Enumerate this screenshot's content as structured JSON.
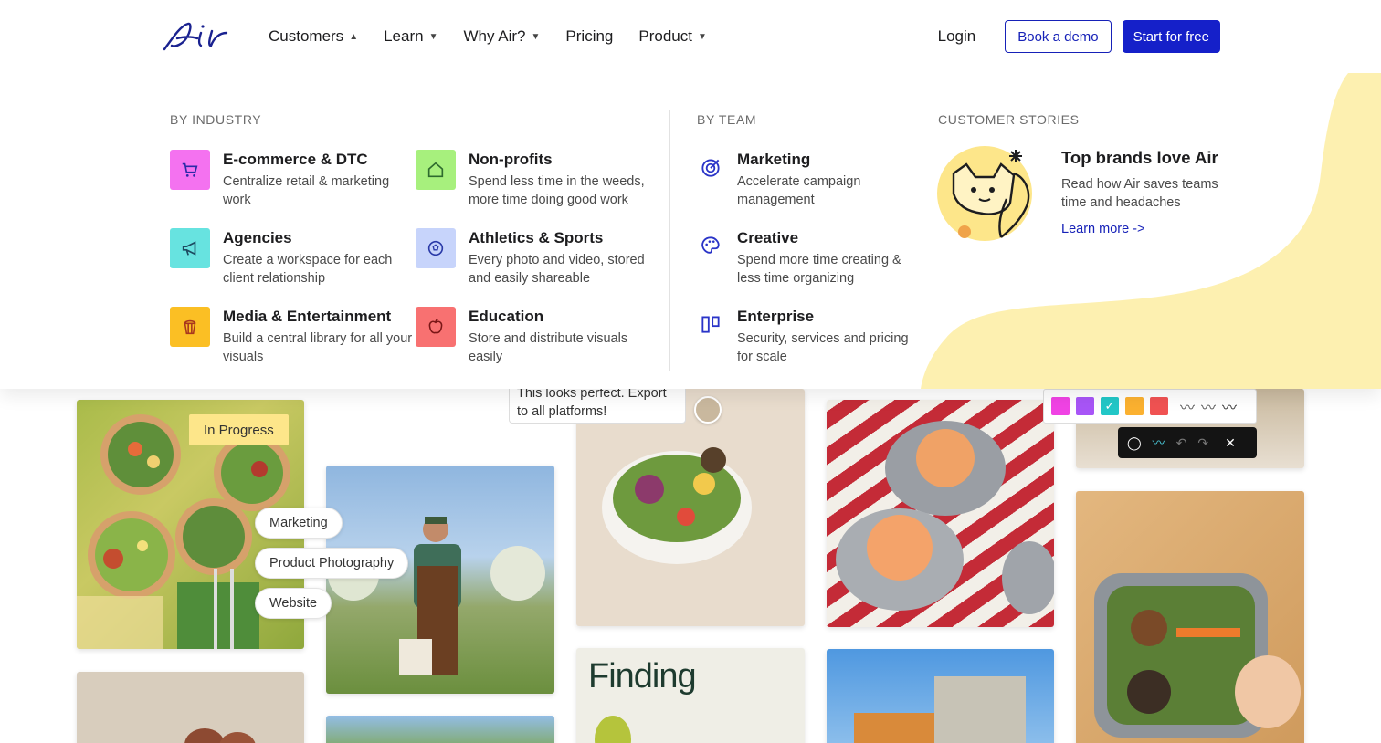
{
  "nav": {
    "links": [
      {
        "label": "Customers"
      },
      {
        "label": "Learn"
      },
      {
        "label": "Why Air?"
      },
      {
        "label": "Pricing"
      },
      {
        "label": "Product"
      }
    ],
    "login": "Login",
    "demo": "Book a demo",
    "start": "Start for free"
  },
  "menu": {
    "industry_title": "BY INDUSTRY",
    "team_title": "BY TEAM",
    "stories_title": "CUSTOMER STORIES",
    "industry": [
      {
        "title": "E-commerce & DTC",
        "desc": "Centralize retail & marketing work",
        "color": "#f472f0"
      },
      {
        "title": "Non-profits",
        "desc": "Spend less time in the weeds, more time doing good work",
        "color": "#a7f07d"
      },
      {
        "title": "Agencies",
        "desc": "Create a workspace for each client relationship",
        "color": "#67e3e0"
      },
      {
        "title": "Athletics & Sports",
        "desc": "Every photo and video, stored and easily shareable",
        "color": "#c7d4fb"
      },
      {
        "title": "Media & Entertainment",
        "desc": "Build a central library for all your visuals",
        "color": "#fbbf24"
      },
      {
        "title": "Education",
        "desc": "Store and distribute visuals easily",
        "color": "#f87171"
      }
    ],
    "team": [
      {
        "title": "Marketing",
        "desc": "Accelerate campaign management"
      },
      {
        "title": "Creative",
        "desc": "Spend more time creating & less time organizing"
      },
      {
        "title": "Enterprise",
        "desc": "Security, services and pricing for scale"
      }
    ],
    "story": {
      "title": "Top brands love Air",
      "desc": "Read how Air saves teams time and headaches",
      "link": "Learn more ->"
    }
  },
  "gallery": {
    "status": "In Progress",
    "tags": [
      "Marketing",
      "Product Photography",
      "Website"
    ],
    "comment": "This looks perfect. Export to all platforms!",
    "card_title": "Finding",
    "swatches": [
      "#f043e4",
      "#a855f7",
      "#22c7c7",
      "#fbb130",
      "#f05252"
    ]
  }
}
